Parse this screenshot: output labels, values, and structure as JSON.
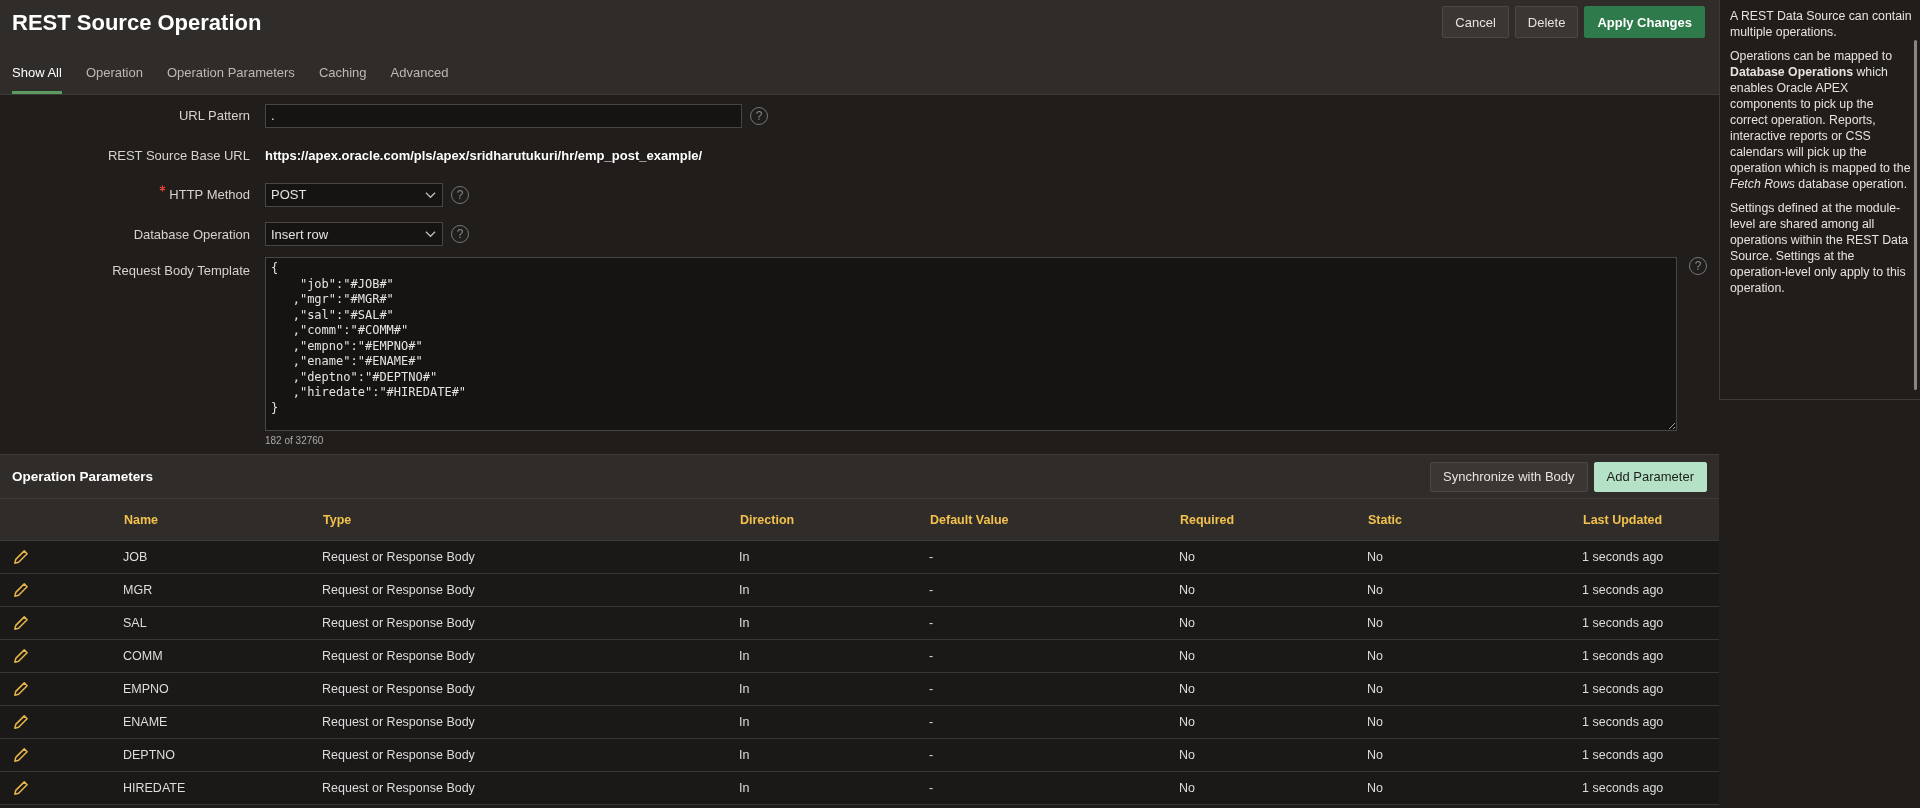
{
  "page": {
    "title": "REST Source Operation",
    "buttons": [
      {
        "label": "Cancel",
        "kind": "default"
      },
      {
        "label": "Delete",
        "kind": "default"
      },
      {
        "label": "Apply Changes",
        "kind": "primary"
      }
    ]
  },
  "tabs": [
    {
      "label": "Show All",
      "selected": true
    },
    {
      "label": "Operation",
      "selected": false
    },
    {
      "label": "Operation Parameters",
      "selected": false
    },
    {
      "label": "Caching",
      "selected": false
    },
    {
      "label": "Advanced",
      "selected": false
    }
  ],
  "form": [
    {
      "kind": "text",
      "label": "URL Pattern",
      "value": ".",
      "help": "?",
      "required": false
    },
    {
      "kind": "display",
      "label": "REST Source Base URL",
      "value": "https://apex.oracle.com/pls/apex/sridharutukuri/hr/emp_post_example/",
      "required": false
    },
    {
      "kind": "select",
      "label": "HTTP Method",
      "value": "POST",
      "help": "?",
      "required": true
    },
    {
      "kind": "select",
      "label": "Database Operation",
      "value": "Insert row",
      "help": "?",
      "required": false
    },
    {
      "kind": "textarea",
      "label": "Request Body Template",
      "value": "{\n    \"job\":\"#JOB#\"\n   ,\"mgr\":\"#MGR#\"\n   ,\"sal\":\"#SAL#\"\n   ,\"comm\":\"#COMM#\"\n   ,\"empno\":\"#EMPNO#\"\n   ,\"ename\":\"#ENAME#\"\n   ,\"deptno\":\"#DEPTNO#\"\n   ,\"hiredate\":\"#HIREDATE#\"\n}",
      "counter": "182 of 32760",
      "help": "?",
      "required": false
    }
  ],
  "parameters": {
    "title": "Operation Parameters",
    "buttons": [
      {
        "label": "Synchronize with Body",
        "kind": "default"
      },
      {
        "label": "Add Parameter",
        "kind": "accent"
      }
    ],
    "columns": [
      "Name",
      "Type",
      "Direction",
      "Default Value",
      "Required",
      "Static",
      "Last Updated"
    ],
    "rows": [
      [
        "JOB",
        "Request or Response Body",
        "In",
        "-",
        "No",
        "No",
        "1 seconds ago"
      ],
      [
        "MGR",
        "Request or Response Body",
        "In",
        "-",
        "No",
        "No",
        "1 seconds ago"
      ],
      [
        "SAL",
        "Request or Response Body",
        "In",
        "-",
        "No",
        "No",
        "1 seconds ago"
      ],
      [
        "COMM",
        "Request or Response Body",
        "In",
        "-",
        "No",
        "No",
        "1 seconds ago"
      ],
      [
        "EMPNO",
        "Request or Response Body",
        "In",
        "-",
        "No",
        "No",
        "1 seconds ago"
      ],
      [
        "ENAME",
        "Request or Response Body",
        "In",
        "-",
        "No",
        "No",
        "1 seconds ago"
      ],
      [
        "DEPTNO",
        "Request or Response Body",
        "In",
        "-",
        "No",
        "No",
        "1 seconds ago"
      ],
      [
        "HIREDATE",
        "Request or Response Body",
        "In",
        "-",
        "No",
        "No",
        "1 seconds ago"
      ]
    ]
  },
  "help": {
    "paragraphs": [
      "A REST Data Source can contain multiple operations.",
      "Operations can be mapped to **Database Operations** which enables Oracle APEX components to pick up the correct operation. Reports, interactive reports or CSS calendars will pick up the operation which is mapped to the *Fetch Rows* database operation.",
      "Settings defined at the module-level are shared among all operations within the REST Data Source. Settings at the operation-level only apply to this operation."
    ]
  }
}
